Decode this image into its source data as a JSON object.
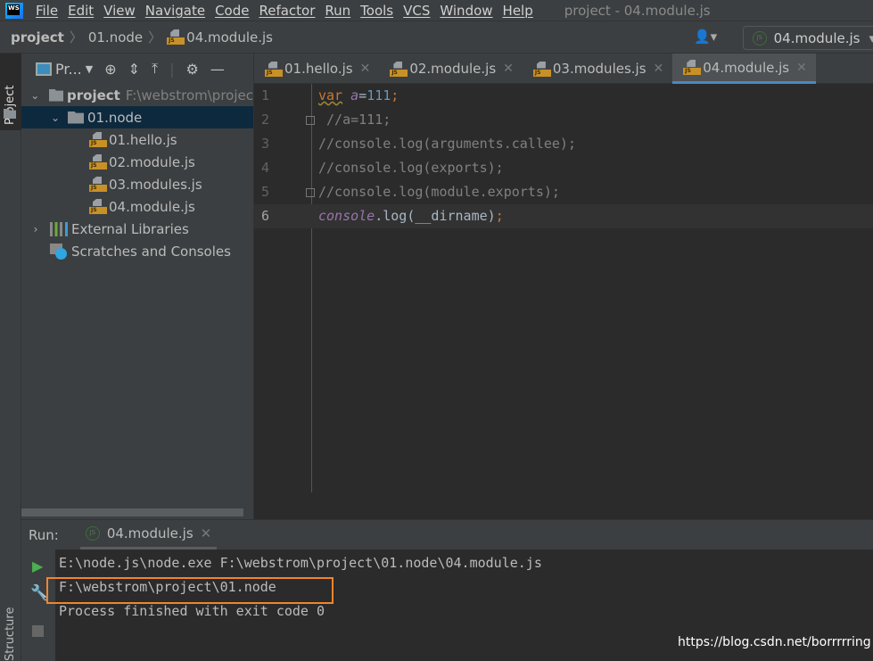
{
  "app": {
    "logo_text": "WS",
    "window_title": "project - 04.module.js"
  },
  "menu": [
    "File",
    "Edit",
    "View",
    "Navigate",
    "Code",
    "Refactor",
    "Run",
    "Tools",
    "VCS",
    "Window",
    "Help"
  ],
  "breadcrumb": [
    "project",
    "01.node",
    "04.module.js"
  ],
  "run_config": {
    "label": "04.module.js"
  },
  "side_tabs": {
    "project": "Project",
    "structure": "Structure"
  },
  "project_panel": {
    "view_label": "Pr...",
    "tree": [
      {
        "label": "project",
        "path": "F:\\webstrom\\projec",
        "type": "folder",
        "expanded": true
      },
      {
        "label": "01.node",
        "type": "folder",
        "expanded": true,
        "selected": true
      },
      {
        "label": "01.hello.js",
        "type": "js"
      },
      {
        "label": "02.module.js",
        "type": "js"
      },
      {
        "label": "03.modules.js",
        "type": "js"
      },
      {
        "label": "04.module.js",
        "type": "js"
      },
      {
        "label": "External Libraries",
        "type": "libraries"
      },
      {
        "label": "Scratches and Consoles",
        "type": "scratches"
      }
    ]
  },
  "editor": {
    "tabs": [
      {
        "label": "01.hello.js"
      },
      {
        "label": "02.module.js"
      },
      {
        "label": "03.modules.js"
      },
      {
        "label": "04.module.js",
        "active": true
      }
    ],
    "lines": [
      {
        "n": "1",
        "parts": [
          [
            "kw",
            "var"
          ],
          [
            "pu",
            " "
          ],
          [
            "it",
            "a"
          ],
          [
            "pu",
            "="
          ],
          [
            "num",
            "111"
          ],
          [
            "kw",
            ";"
          ]
        ]
      },
      {
        "n": "2",
        "parts": [
          [
            "cm",
            " //a=111;"
          ]
        ]
      },
      {
        "n": "3",
        "parts": [
          [
            "cm",
            "//console.log(arguments.callee);"
          ]
        ]
      },
      {
        "n": "4",
        "parts": [
          [
            "cm",
            "//console.log(exports);"
          ]
        ]
      },
      {
        "n": "5",
        "parts": [
          [
            "cm",
            "//console.log(module.exports);"
          ]
        ]
      },
      {
        "n": "6",
        "parts": [
          [
            "it",
            "console"
          ],
          [
            "pu",
            ".log(__dirname)"
          ],
          [
            "kw",
            ";"
          ]
        ]
      }
    ]
  },
  "run": {
    "label": "Run:",
    "tab": "04.module.js",
    "output": [
      "E:\\node.js\\node.exe F:\\webstrom\\project\\01.node\\04.module.js",
      "F:\\webstrom\\project\\01.node",
      "Process finished with exit code 0"
    ]
  },
  "colors": {
    "highlight_box": "#f0852d",
    "active_tab": "#4a88c7",
    "selection": "#0d293e"
  },
  "watermark": "https://blog.csdn.net/borrrrring"
}
